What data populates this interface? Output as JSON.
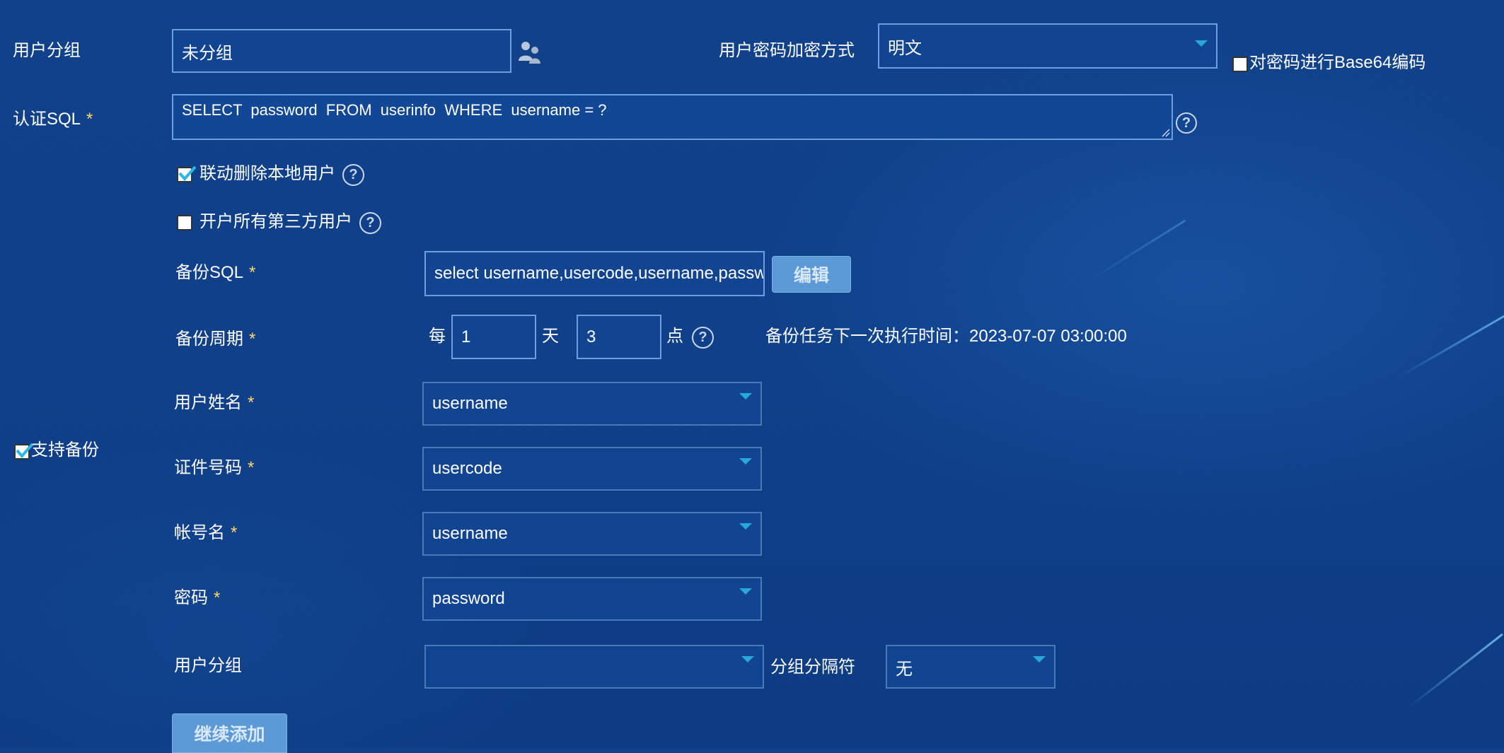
{
  "top": {
    "group_label": "用户分组",
    "group_value": "未分组",
    "pwd_enc_label": "用户密码加密方式",
    "pwd_enc_value": "明文",
    "base64_label": "对密码进行Base64编码",
    "base64_checked": false
  },
  "auth_sql": {
    "label": "认证SQL",
    "required_mark": "*",
    "value": "SELECT  password  FROM  userinfo  WHERE  username = ?"
  },
  "options": {
    "cascade_delete_label": "联动删除本地用户",
    "cascade_delete_checked": true,
    "open_all_third_label": "开户所有第三方用户",
    "open_all_third_checked": false
  },
  "backup": {
    "support_label": "支持备份",
    "support_checked": true,
    "sql_label": "备份SQL",
    "sql_value": "select username,usercode,username,password from userinfo",
    "edit_button": "编辑",
    "period_label": "备份周期",
    "every_label": "每",
    "day_value": "1",
    "day_unit": "天",
    "hour_value": "3",
    "hour_unit": "点",
    "next_run_text": "备份任务下一次执行时间：2023-07-07 03:00:00"
  },
  "fields": [
    {
      "label": "用户姓名",
      "value": "username",
      "required": true
    },
    {
      "label": "证件号码",
      "value": "usercode",
      "required": true
    },
    {
      "label": "帐号名",
      "value": "username",
      "required": true
    },
    {
      "label": "密码",
      "value": "password",
      "required": true
    }
  ],
  "user_group_field": {
    "label": "用户分组",
    "value": "",
    "separator_label": "分组分隔符",
    "separator_value": "无"
  },
  "continue_add_button": "继续添加",
  "colors": {
    "background": "#0f4089",
    "required_star": "#ffd866",
    "caret": "#29a7d6",
    "button": "#5b9ad6",
    "check": "#2ab7e8"
  },
  "icons": {
    "group_icon": "users-icon",
    "help_icon": "question-circle-icon",
    "dropdown_icon": "caret-down-icon"
  }
}
